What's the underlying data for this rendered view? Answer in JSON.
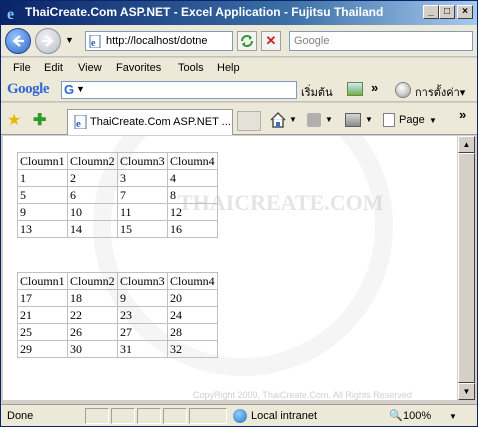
{
  "window": {
    "title": "ThaiCreate.Com ASP.NET - Excel Application - Fujitsu Thailand",
    "min_label": "_",
    "max_label": "□",
    "close_label": "×"
  },
  "nav": {
    "address": "http://localhost/dotne",
    "search_placeholder": "Google",
    "stop_label": "✕"
  },
  "menu": [
    "File",
    "Edit",
    "View",
    "Favorites",
    "Tools",
    "Help"
  ],
  "google_toolbar": {
    "logo": "Google",
    "g_letter": "G",
    "start_label": "เริ่มต้น",
    "more_label": "»",
    "settings_label": "การตั้งค่า▾"
  },
  "tabs": {
    "active_label": "ThaiCreate.Com ASP.NET ...",
    "page_label": "Page",
    "more_label": "»"
  },
  "content": {
    "watermark": "THAICREATE.COM",
    "copyright": "CopyRight 2009, ThaiCreate.Com. All Rights Reserved",
    "table1": {
      "headers": [
        "Cloumn1",
        "Cloumn2",
        "Cloumn3",
        "Cloumn4"
      ],
      "rows": [
        [
          "1",
          "2",
          "3",
          "4"
        ],
        [
          "5",
          "6",
          "7",
          "8"
        ],
        [
          "9",
          "10",
          "11",
          "12"
        ],
        [
          "13",
          "14",
          "15",
          "16"
        ]
      ]
    },
    "table2": {
      "headers": [
        "Cloumn1",
        "Cloumn2",
        "Cloumn3",
        "Cloumn4"
      ],
      "rows": [
        [
          "17",
          "18",
          "9",
          "20"
        ],
        [
          "21",
          "22",
          "23",
          "24"
        ],
        [
          "25",
          "26",
          "27",
          "28"
        ],
        [
          "29",
          "30",
          "31",
          "32"
        ]
      ]
    }
  },
  "status": {
    "text": "Done",
    "zone": "Local intranet",
    "zoom": "100%"
  },
  "colors": {
    "title_bar": "#0a246a",
    "chrome": "#ece9d8",
    "grid_border": "#c0c0c0"
  }
}
